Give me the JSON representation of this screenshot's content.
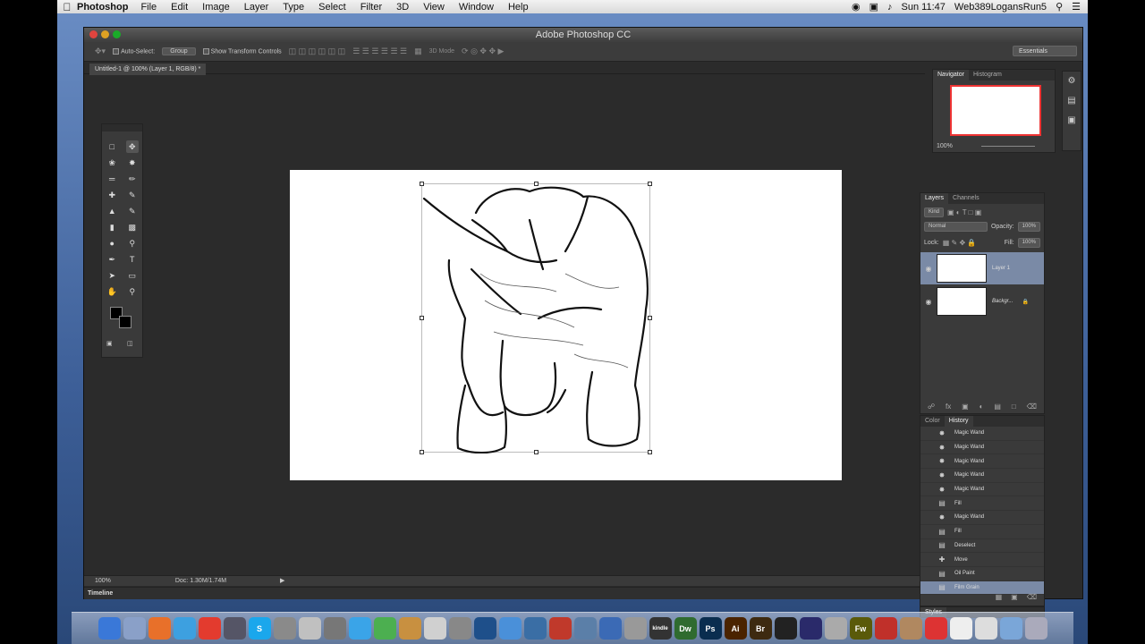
{
  "menubar": {
    "app": "Photoshop",
    "items": [
      "File",
      "Edit",
      "Image",
      "Layer",
      "Type",
      "Select",
      "Filter",
      "3D",
      "View",
      "Window",
      "Help"
    ],
    "clock": "Sun 11:47",
    "user": "Web389LogansRun5"
  },
  "window": {
    "title": "Adobe Photoshop CC"
  },
  "options": {
    "auto_select_label": "Auto-Select:",
    "auto_select_value": "Group",
    "show_transform_label": "Show Transform Controls",
    "mode_3d": "3D Mode",
    "workspace": "Essentials"
  },
  "document": {
    "tab": "Untitled-1 @ 100% (Layer 1, RGB/8) *"
  },
  "status": {
    "zoom": "100%",
    "doc": "Doc: 1.30M/1.74M"
  },
  "timeline": {
    "label": "Timeline"
  },
  "navigator": {
    "tabs": [
      "Navigator",
      "Histogram"
    ],
    "zoom": "100%"
  },
  "layers": {
    "tabs": [
      "Layers",
      "Channels"
    ],
    "kind": "Kind",
    "blend": "Normal",
    "opacity_label": "Opacity:",
    "opacity": "100%",
    "lock_label": "Lock:",
    "fill_label": "Fill:",
    "fill": "100%",
    "items": [
      {
        "name": "Layer 1"
      },
      {
        "name": "Backgr..."
      }
    ]
  },
  "history": {
    "tabs": [
      "Color",
      "History"
    ],
    "items": [
      {
        "label": "Magic Wand",
        "icon": "wand-icon"
      },
      {
        "label": "Magic Wand",
        "icon": "wand-icon"
      },
      {
        "label": "Magic Wand",
        "icon": "wand-icon"
      },
      {
        "label": "Magic Wand",
        "icon": "wand-icon"
      },
      {
        "label": "Magic Wand",
        "icon": "wand-icon"
      },
      {
        "label": "Fill",
        "icon": "document-icon"
      },
      {
        "label": "Magic Wand",
        "icon": "wand-icon"
      },
      {
        "label": "Fill",
        "icon": "document-icon"
      },
      {
        "label": "Deselect",
        "icon": "document-icon"
      },
      {
        "label": "Move",
        "icon": "move-icon"
      },
      {
        "label": "Oil Paint",
        "icon": "document-icon"
      },
      {
        "label": "Film Grain",
        "icon": "document-icon"
      }
    ]
  },
  "styles": {
    "label": "Styles"
  },
  "dock": {
    "apps": [
      {
        "label": "",
        "color": "#3a78d8"
      },
      {
        "label": "",
        "color": "#8aa0c8"
      },
      {
        "label": "",
        "color": "#e8702a"
      },
      {
        "label": "",
        "color": "#3da0e0"
      },
      {
        "label": "",
        "color": "#e33b2e"
      },
      {
        "label": "",
        "color": "#556"
      },
      {
        "label": "S",
        "color": "#1aa7ec"
      },
      {
        "label": "",
        "color": "#8a8a8a"
      },
      {
        "label": "",
        "color": "#c0c0c0"
      },
      {
        "label": "",
        "color": "#777"
      },
      {
        "label": "",
        "color": "#3aa4e8"
      },
      {
        "label": "",
        "color": "#4caf50"
      },
      {
        "label": "",
        "color": "#c89040"
      },
      {
        "label": "",
        "color": "#d0d0d0"
      },
      {
        "label": "",
        "color": "#888"
      },
      {
        "label": "",
        "color": "#1e4f8a"
      },
      {
        "label": "",
        "color": "#4a90d9"
      },
      {
        "label": "",
        "color": "#3a6ea5"
      },
      {
        "label": "",
        "color": "#c0392b"
      },
      {
        "label": "",
        "color": "#5b7fa8"
      },
      {
        "label": "",
        "color": "#3b6ab5"
      },
      {
        "label": "",
        "color": "#999"
      },
      {
        "label": "kindle",
        "color": "#333"
      },
      {
        "label": "Dw",
        "color": "#2f6b2f"
      },
      {
        "label": "Ps",
        "color": "#0a2d4f"
      },
      {
        "label": "Ai",
        "color": "#4a2300"
      },
      {
        "label": "Br",
        "color": "#3d2a10"
      },
      {
        "label": "",
        "color": "#222"
      },
      {
        "label": "",
        "color": "#2a2a6a"
      },
      {
        "label": "",
        "color": "#aaa"
      },
      {
        "label": "Fw",
        "color": "#5a5a0a"
      },
      {
        "label": "",
        "color": "#c0302a"
      },
      {
        "label": "",
        "color": "#b08860"
      },
      {
        "label": "",
        "color": "#d33"
      },
      {
        "label": "",
        "color": "#eee"
      },
      {
        "label": "",
        "color": "#ddd"
      },
      {
        "label": "",
        "color": "#7aa6d8"
      },
      {
        "label": "",
        "color": "#aab"
      }
    ]
  }
}
